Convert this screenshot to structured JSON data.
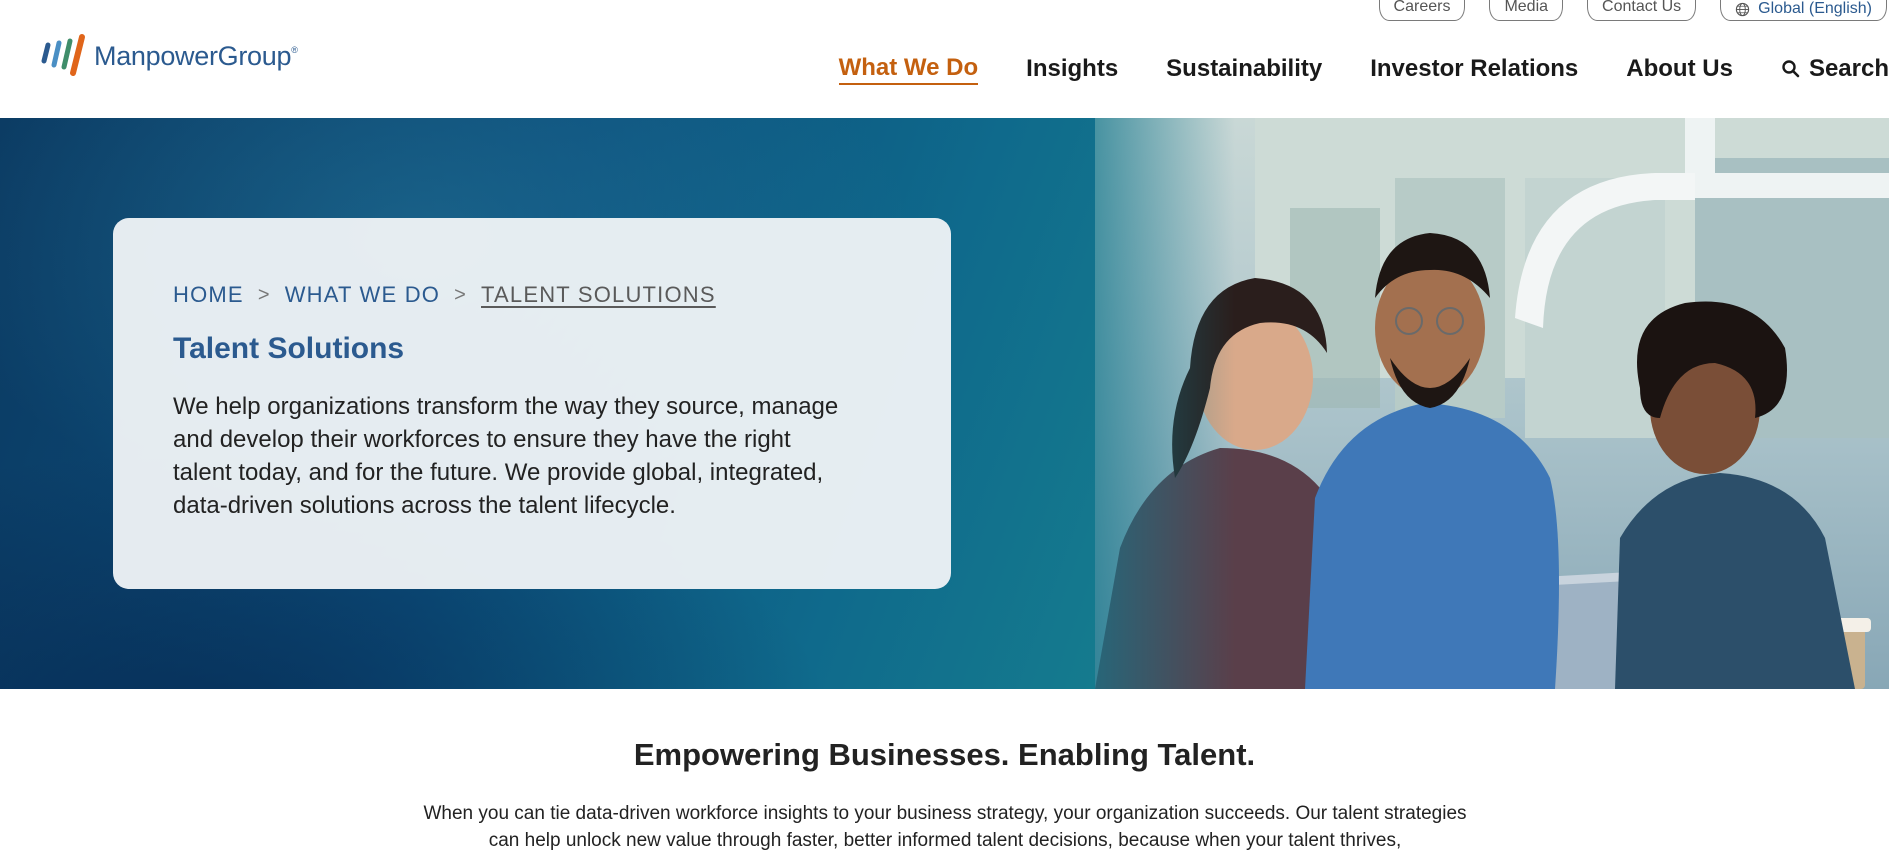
{
  "brand": {
    "name": "ManpowerGroup",
    "trademark": "®",
    "colors": {
      "blue": "#2b5a8f",
      "orange": "#c4600f"
    }
  },
  "utility_nav": {
    "careers": "Careers",
    "media": "Media",
    "contact": "Contact Us",
    "language": "Global (English)",
    "language_icon": "globe-icon"
  },
  "main_nav": {
    "items": [
      {
        "label": "What We Do",
        "active": true
      },
      {
        "label": "Insights",
        "active": false
      },
      {
        "label": "Sustainability",
        "active": false
      },
      {
        "label": "Investor Relations",
        "active": false
      },
      {
        "label": "About Us",
        "active": false
      }
    ],
    "search_label": "Search",
    "search_icon": "search-icon"
  },
  "hero": {
    "breadcrumb": [
      "HOME",
      "WHAT WE DO",
      "TALENT SOLUTIONS"
    ],
    "breadcrumb_sep": ">",
    "title": "Talent Solutions",
    "body": "We help organizations transform the way they source, manage and develop their workforces to ensure they have the right talent today, and for the future. We provide global, integrated, data-driven solutions across the talent lifecycle."
  },
  "intro": {
    "title": "Empowering Businesses. Enabling Talent.",
    "body": "When you can tie data-driven workforce insights to your business strategy, your organization succeeds. Our talent strategies can help unlock new value through faster, better informed talent decisions, because when your talent thrives,"
  }
}
